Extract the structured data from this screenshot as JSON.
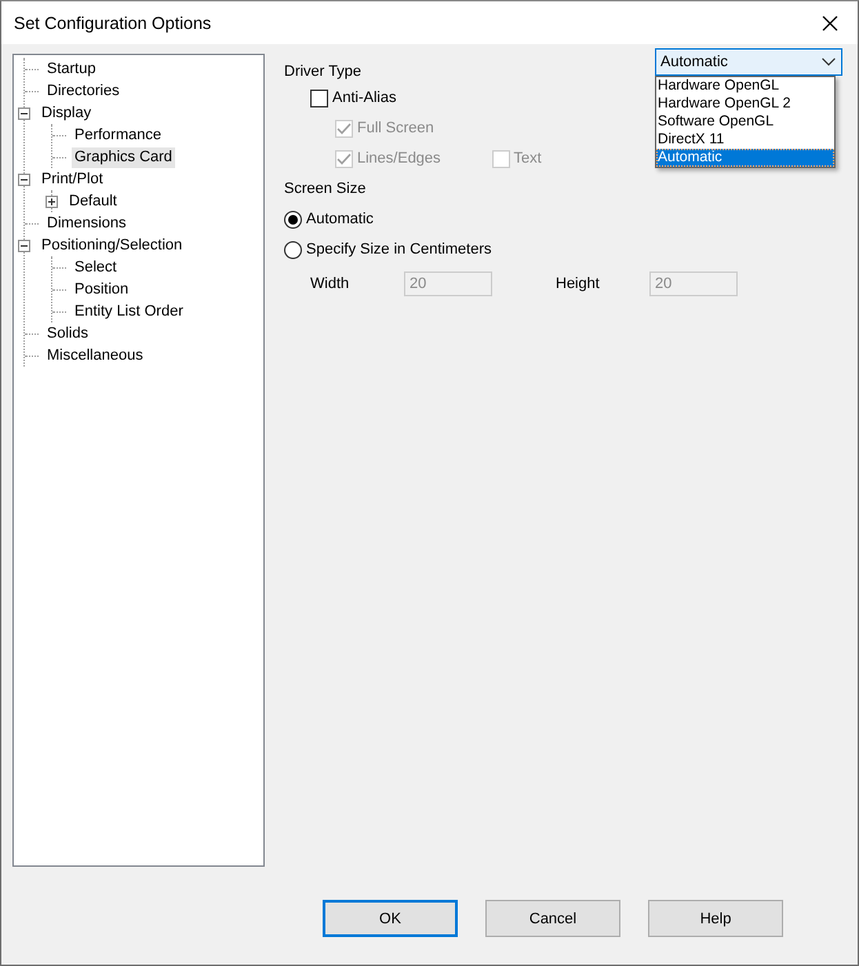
{
  "window": {
    "title": "Set Configuration Options"
  },
  "tree": [
    {
      "label": "Startup",
      "selected": false
    },
    {
      "label": "Directories",
      "selected": false
    },
    {
      "label": "Display",
      "selected": false,
      "expanded": true,
      "children": [
        {
          "label": "Performance",
          "selected": false
        },
        {
          "label": "Graphics Card",
          "selected": true
        }
      ]
    },
    {
      "label": "Print/Plot",
      "selected": false,
      "expanded": true,
      "children": [
        {
          "label": "Default",
          "selected": false,
          "expanded": false
        }
      ]
    },
    {
      "label": "Dimensions",
      "selected": false
    },
    {
      "label": "Positioning/Selection",
      "selected": false,
      "expanded": true,
      "children": [
        {
          "label": "Select",
          "selected": false
        },
        {
          "label": "Position",
          "selected": false
        },
        {
          "label": "Entity List Order",
          "selected": false
        }
      ]
    },
    {
      "label": "Solids",
      "selected": false
    },
    {
      "label": "Miscellaneous",
      "selected": false
    }
  ],
  "driver_type": {
    "label": "Driver Type",
    "value": "Automatic",
    "open": true,
    "options": [
      {
        "label": "Hardware OpenGL",
        "selected": false
      },
      {
        "label": "Hardware OpenGL 2",
        "selected": false
      },
      {
        "label": "Software OpenGL",
        "selected": false
      },
      {
        "label": "DirectX 11",
        "selected": false
      },
      {
        "label": "Automatic",
        "selected": true
      }
    ]
  },
  "anti_alias": {
    "label": "Anti-Alias",
    "checked": false,
    "disabled": false
  },
  "anti_alias_options": [
    [
      {
        "label": "Full Screen",
        "checked": true,
        "disabled": true
      }
    ],
    [
      {
        "label": "Lines/Edges",
        "checked": true,
        "disabled": true
      },
      {
        "label": "Text",
        "checked": false,
        "disabled": true
      }
    ]
  ],
  "screen_size": {
    "label": "Screen Size",
    "options": [
      {
        "label": "Automatic",
        "selected": true
      },
      {
        "label": "Specify Size in Centimeters",
        "selected": false
      }
    ],
    "fields": [
      {
        "label": "Width",
        "value": "20",
        "disabled": true
      },
      {
        "label": "Height",
        "value": "20",
        "disabled": true
      }
    ]
  },
  "buttons": [
    {
      "label": "OK",
      "default": true
    },
    {
      "label": "Cancel",
      "default": false
    },
    {
      "label": "Help",
      "default": false
    }
  ]
}
